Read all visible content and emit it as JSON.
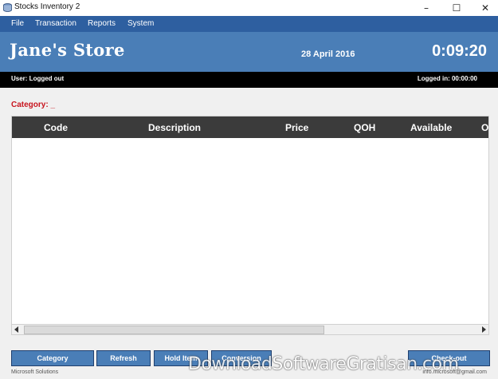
{
  "window": {
    "title": "Stocks Inventory 2"
  },
  "menu": {
    "file": "File",
    "transaction": "Transaction",
    "reports": "Reports",
    "system": "System"
  },
  "header": {
    "store_name": "Jane's Store",
    "date": "28 April 2016",
    "time": "0:09:20"
  },
  "status": {
    "user": "User: Logged out",
    "logged_in": "Logged in:  00:00:00"
  },
  "category": {
    "label": "Category: _"
  },
  "table": {
    "columns": [
      "Code",
      "Description",
      "Price",
      "QOH",
      "Available",
      "O"
    ]
  },
  "buttons": {
    "category": "Category",
    "refresh": "Refresh",
    "hold": "Hold Item",
    "conversion": "Conversion",
    "checkout": "Check-out"
  },
  "footer": {
    "left": "Microsoft Solutions",
    "right": "info.microsoft@gmail.com"
  },
  "watermark": {
    "text": "DownloadSoftwareGratisan.com"
  },
  "colors": {
    "menubar": "#2e5fa0",
    "header": "#4a7eb7",
    "category_label": "#c8141e",
    "grid_header": "#3b3b3b"
  }
}
